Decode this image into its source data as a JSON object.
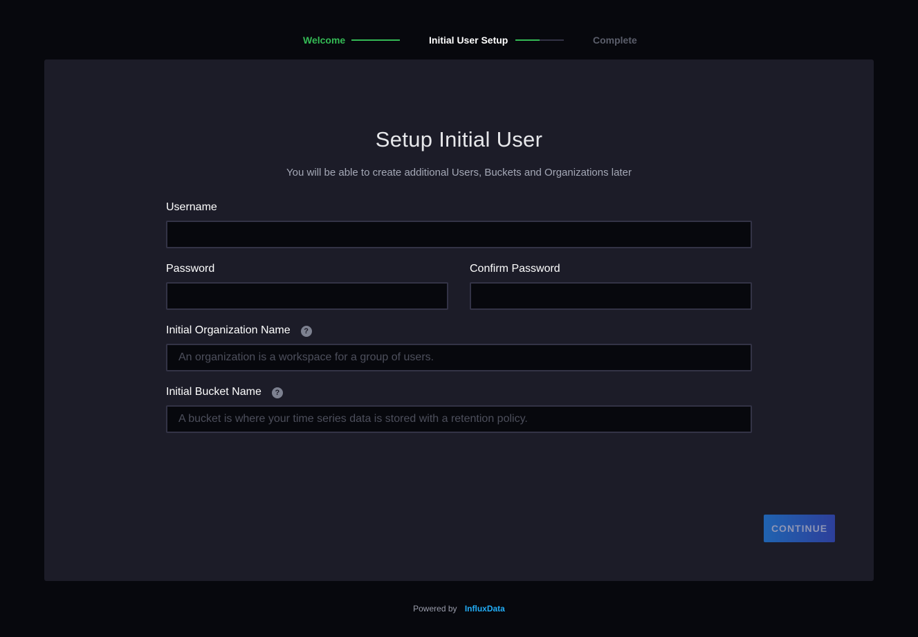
{
  "stepper": {
    "steps": [
      {
        "label": "Welcome",
        "status": "done"
      },
      {
        "label": "Initial User Setup",
        "status": "current"
      },
      {
        "label": "Complete",
        "status": "pending"
      }
    ],
    "current_step_progress": 0.5,
    "colors": {
      "done": "#34bb55",
      "current": "#ffffff",
      "pending": "#5b5e6b"
    }
  },
  "form": {
    "title": "Setup Initial User",
    "subtitle": "You will be able to create additional Users, Buckets and Organizations later",
    "username": {
      "label": "Username",
      "value": "",
      "placeholder": ""
    },
    "password": {
      "label": "Password",
      "value": "",
      "placeholder": ""
    },
    "confirm_password": {
      "label": "Confirm Password",
      "value": "",
      "placeholder": ""
    },
    "org_name": {
      "label": "Initial Organization Name",
      "value": "",
      "placeholder": "An organization is a workspace for a group of users.",
      "help_icon": "question-icon"
    },
    "bucket_name": {
      "label": "Initial Bucket Name",
      "value": "",
      "placeholder": "A bucket is where your time series data is stored with a retention policy.",
      "help_icon": "question-icon"
    },
    "continue_label": "CONTINUE"
  },
  "footer": {
    "powered_by": "Powered by",
    "brand": "InfluxData",
    "brand_color": "#22adf6"
  }
}
